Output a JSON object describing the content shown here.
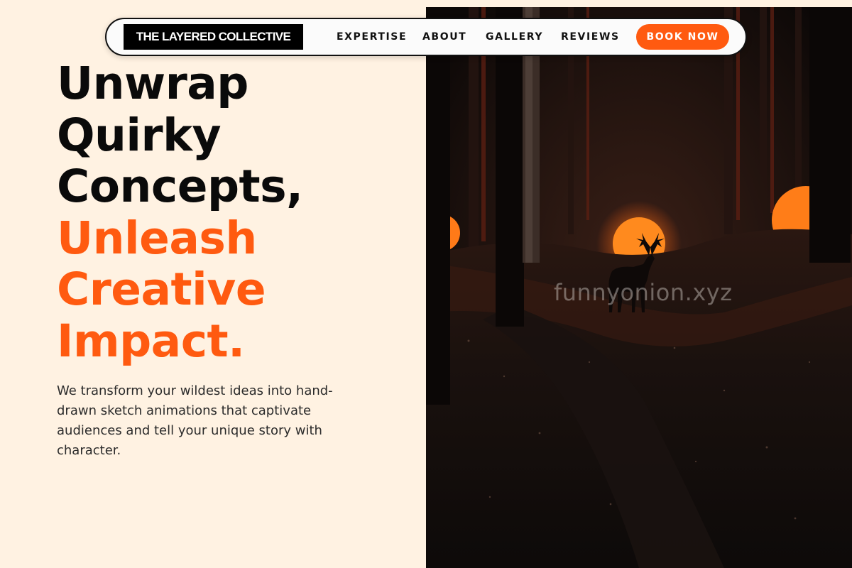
{
  "nav": {
    "logo": "THE LAYERED COLLECTIVE",
    "links": [
      "EXPERTISE",
      "ABOUT",
      "GALLERY",
      "REVIEWS"
    ],
    "cta": "BOOK NOW"
  },
  "hero": {
    "headline_lines": [
      "Unwrap",
      "Quirky",
      "Concepts,"
    ],
    "accent_lines": [
      "Unleash",
      "Creative",
      "Impact."
    ],
    "description": "We transform your wildest ideas into hand-drawn sketch animations that captivate audiences and tell your unique story with character.",
    "image_watermark": "funnyonion.xyz"
  },
  "colors": {
    "background": "#fff2e2",
    "accent": "#ff5a10",
    "text": "#0a0a0a"
  }
}
